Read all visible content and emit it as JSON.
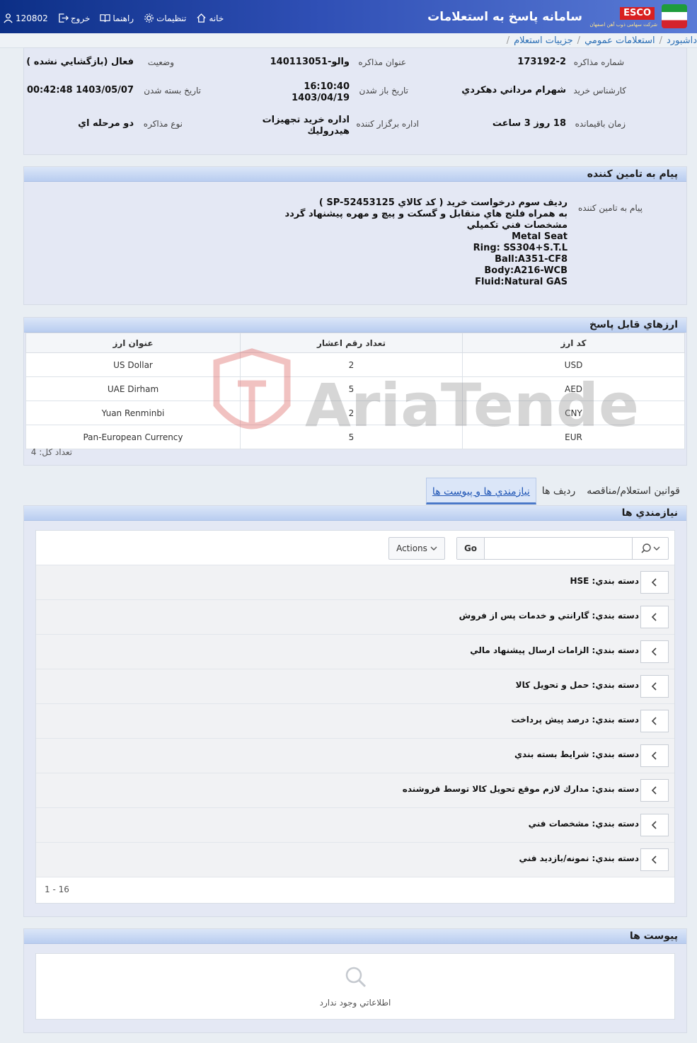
{
  "header": {
    "app_title": "سامانه پاسخ به استعلامات",
    "logo_text": "ESCO",
    "logo_subtitle": "شرکت سهامی ذوب آهن اصفهان",
    "nav": {
      "home": "خانه",
      "settings": "تنظيمات",
      "help": "راهنما",
      "logout": "خروج",
      "user_id": "120802"
    }
  },
  "breadcrumb": [
    "داشبورد",
    "استعلامات عمومي",
    "جزييات استعلام"
  ],
  "info": {
    "negotiation_number_label": "شماره مذاکره",
    "negotiation_number": "173192-2",
    "negotiation_title_label": "عنوان مذاکره",
    "negotiation_title": "والو-140113051",
    "status_label": "وضعيت",
    "status": "فعال (بازگشايي نشده )",
    "buyer_expert_label": "کارشناس خريد",
    "buyer_expert": "شهرام مرداني دهکردي",
    "open_date_label": "تاريخ باز شدن",
    "open_time": "16:10:40",
    "open_date": "1403/04/19",
    "close_date_label": "تاريخ بسته شدن",
    "close_date": "1403/05/07 00:42:48",
    "remaining_label": "زمان باقيمانده",
    "remaining": "18 روز 3 ساعت",
    "organizer_label": "اداره برگزار کننده",
    "organizer_line1": "اداره خريد تجهيزات",
    "organizer_line2": "هيدروليك",
    "type_label": "نوع مذاکره",
    "type": "دو مرحله اي"
  },
  "supplier_message": {
    "title": "پيام به تامين کننده",
    "label": "پيام به تامين کننده",
    "lines": [
      "رديف سوم درخواست خريد ( کد کالاي SP-52453125 )",
      "به همراه فلنج هاي متقابل و گسکت و پيچ و مهره پيشنهاد گردد",
      "مشخصات فني تکميلي",
      "Metal Seat",
      "Ring: SS304+S.T.L",
      "Ball:A351-CF8",
      "Body:A216-WCB",
      "Fluid:Natural GAS"
    ]
  },
  "currencies": {
    "title": "ارزهاي قابل پاسخ",
    "columns": [
      "کد ارز",
      "تعداد رقم اعشار",
      "عنوان ارز"
    ],
    "rows": [
      {
        "code": "USD",
        "decimals": "2",
        "name": "US Dollar"
      },
      {
        "code": "AED",
        "decimals": "5",
        "name": "UAE Dirham"
      },
      {
        "code": "CNY",
        "decimals": "2",
        "name": "Yuan Renminbi"
      },
      {
        "code": "EUR",
        "decimals": "5",
        "name": "Pan-European Currency"
      }
    ],
    "total_label": "تعداد کل: 4"
  },
  "watermark_text": "AriaTender.neT",
  "tabs": [
    "نيازمندي ها و پيوست ها",
    "رديف ها",
    "قوانين استعلام/مناقصه"
  ],
  "requirements": {
    "title": "نيازمندي ها",
    "go_label": "Go",
    "actions_label": "Actions",
    "items": [
      "دسته بندي: HSE",
      "دسته بندي: گارانتي و خدمات پس از فروش",
      "دسته بندي: الزامات ارسال پيشنهاد مالي",
      "دسته بندي: حمل و تحويل کالا",
      "دسته بندي: درصد پيش پرداخت",
      "دسته بندي: شرايط بسته بندي",
      "دسته بندي: مدارك لازم موقع تحويل کالا توسط فروشنده",
      "دسته بندي: مشخصات فني",
      "دسته بندي: نمونه/بازديد فني"
    ],
    "pager": "1 - 16"
  },
  "attachments": {
    "title": "پيوست ها",
    "empty_text": "اطلاعاتي وجود ندارد"
  },
  "colors": {
    "header_blue": "#0c2f86",
    "link_blue": "#2c6fb5",
    "panel_bg": "#e4e8f4",
    "watermark_red": "#d9534f"
  }
}
